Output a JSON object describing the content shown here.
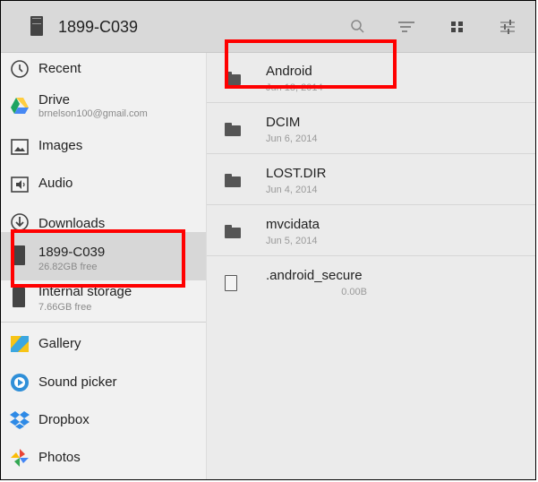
{
  "header": {
    "title": "1899-C039"
  },
  "sidebar": {
    "items": [
      {
        "label": "Recent"
      },
      {
        "label": "Drive",
        "sub": "brnelson100@gmail.com"
      },
      {
        "label": "Images"
      },
      {
        "label": "Audio"
      },
      {
        "label": "Downloads"
      },
      {
        "label": "1899-C039",
        "sub": "26.82GB free"
      },
      {
        "label": "Internal storage",
        "sub": "7.66GB free"
      },
      {
        "label": "Gallery"
      },
      {
        "label": "Sound picker"
      },
      {
        "label": "Dropbox"
      },
      {
        "label": "Photos"
      }
    ]
  },
  "files": [
    {
      "name": "Android",
      "date": "Jun 18, 2014"
    },
    {
      "name": "DCIM",
      "date": "Jun 6, 2014"
    },
    {
      "name": "LOST.DIR",
      "date": "Jun 4, 2014"
    },
    {
      "name": "mvcidata",
      "date": "Jun 5, 2014"
    },
    {
      "name": ".android_secure",
      "size": "0.00B"
    }
  ],
  "colors": {
    "highlight": "#ff0000",
    "drive_green": "#1da462",
    "drive_yellow": "#ffcd40",
    "drive_blue": "#4688f4",
    "dropbox_blue": "#2e8ae6"
  }
}
